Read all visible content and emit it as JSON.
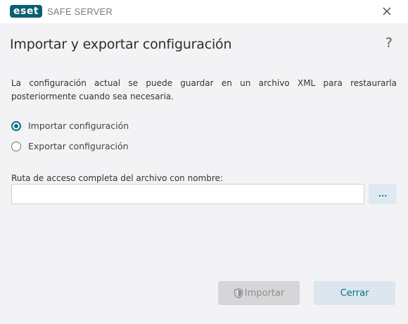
{
  "window": {
    "logo_text": "eset",
    "product_name": "SAFE SERVER",
    "close_icon": "close-icon"
  },
  "dialog": {
    "title": "Importar y exportar configuración",
    "help_label": "?",
    "description": "La configuración actual se puede guardar en un archivo XML para restaurarla posteriormente cuando sea necesaria.",
    "options": [
      {
        "label": "Importar configuración",
        "selected": true
      },
      {
        "label": "Exportar configuración",
        "selected": false
      }
    ],
    "path_label": "Ruta de acceso completa del archivo con nombre:",
    "path_value": "",
    "browse_label": "...",
    "import_button": "Importar",
    "import_enabled": false,
    "close_button": "Cerrar"
  },
  "colors": {
    "accent": "#0b6f86",
    "logo_bg": "#0a5f74",
    "content_bg": "#f3f3f5"
  }
}
